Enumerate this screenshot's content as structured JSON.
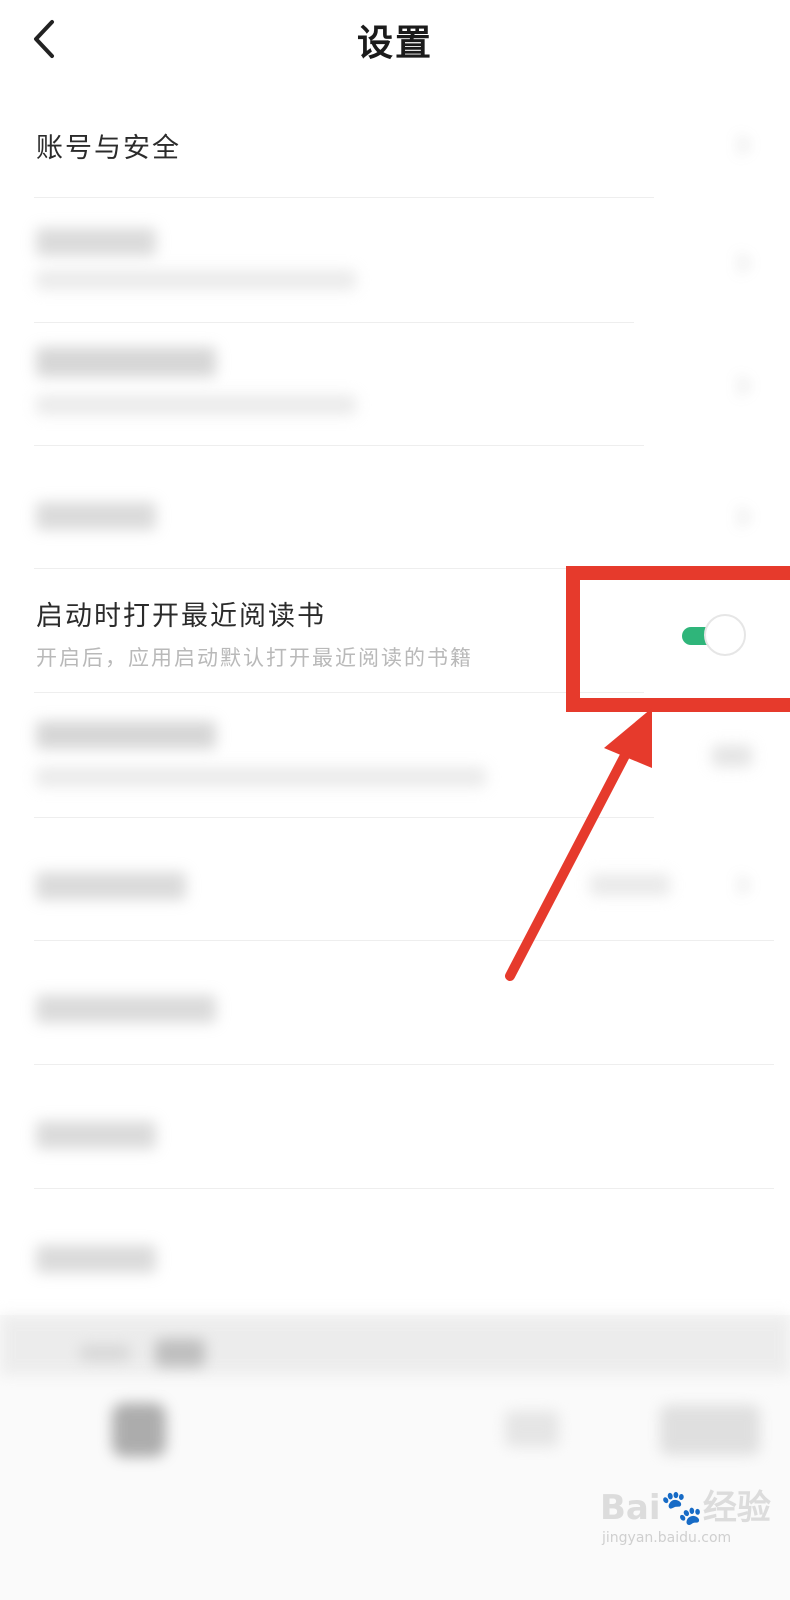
{
  "header": {
    "title": "设置"
  },
  "settings": {
    "account_security": "账号与安全",
    "open_recent_book": {
      "label": "启动时打开最近阅读书",
      "description": "开启后，应用启动默认打开最近阅读的书籍",
      "enabled": true
    }
  },
  "watermark": {
    "brand": "Bai🐾经验",
    "url": "jingyan.baidu.com"
  },
  "colors": {
    "toggle_on": "#2fb57a",
    "highlight": "#e63a2c"
  }
}
